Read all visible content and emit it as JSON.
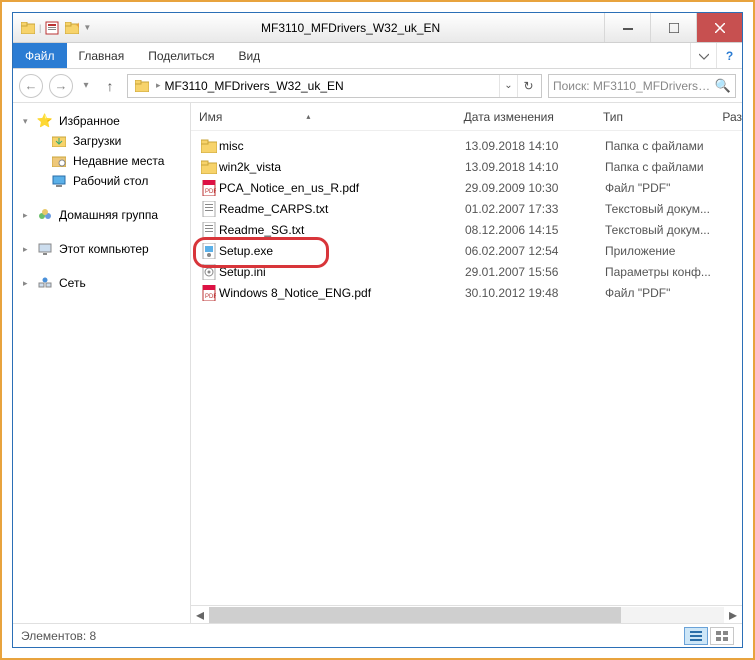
{
  "titlebar": {
    "title": "MF3110_MFDrivers_W32_uk_EN"
  },
  "ribbon": {
    "file": "Файл",
    "tabs": [
      "Главная",
      "Поделиться",
      "Вид"
    ]
  },
  "address": {
    "crumb": "MF3110_MFDrivers_W32_uk_EN",
    "search_placeholder": "Поиск: MF3110_MFDrivers_W..."
  },
  "nav": {
    "favorites": {
      "label": "Избранное",
      "items": [
        "Загрузки",
        "Недавние места",
        "Рабочий стол"
      ]
    },
    "homegroup": "Домашняя группа",
    "computer": "Этот компьютер",
    "network": "Сеть"
  },
  "columns": {
    "name": "Имя",
    "date": "Дата изменения",
    "type": "Тип",
    "size": "Раз"
  },
  "files": [
    {
      "icon": "folder",
      "name": "misc",
      "date": "13.09.2018 14:10",
      "type": "Папка с файлами"
    },
    {
      "icon": "folder",
      "name": "win2k_vista",
      "date": "13.09.2018 14:10",
      "type": "Папка с файлами"
    },
    {
      "icon": "pdf",
      "name": "PCA_Notice_en_us_R.pdf",
      "date": "29.09.2009 10:30",
      "type": "Файл \"PDF\""
    },
    {
      "icon": "txt",
      "name": "Readme_CARPS.txt",
      "date": "01.02.2007 17:33",
      "type": "Текстовый докум..."
    },
    {
      "icon": "txt",
      "name": "Readme_SG.txt",
      "date": "08.12.2006 14:15",
      "type": "Текстовый докум..."
    },
    {
      "icon": "exe",
      "name": "Setup.exe",
      "date": "06.02.2007 12:54",
      "type": "Приложение",
      "highlight": true
    },
    {
      "icon": "ini",
      "name": "Setup.ini",
      "date": "29.01.2007 15:56",
      "type": "Параметры конф..."
    },
    {
      "icon": "pdf",
      "name": "Windows 8_Notice_ENG.pdf",
      "date": "30.10.2012 19:48",
      "type": "Файл \"PDF\""
    }
  ],
  "status": {
    "text": "Элементов: 8"
  }
}
